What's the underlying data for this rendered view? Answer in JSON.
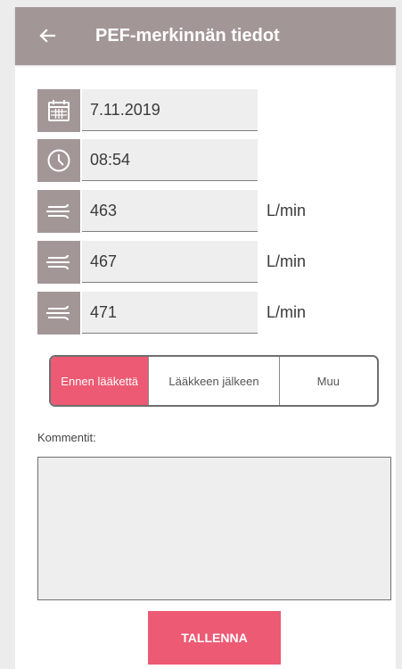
{
  "appbar": {
    "title": "PEF-merkinnän tiedot",
    "back_icon": "arrow-left-icon"
  },
  "fields": {
    "date": {
      "value": "7.11.2019",
      "icon": "calendar-icon"
    },
    "time": {
      "value": "08:54",
      "icon": "clock-icon"
    },
    "readings": [
      {
        "value": "463",
        "unit": "L/min",
        "icon": "airflow-icon"
      },
      {
        "value": "467",
        "unit": "L/min",
        "icon": "airflow-icon"
      },
      {
        "value": "471",
        "unit": "L/min",
        "icon": "airflow-icon"
      }
    ]
  },
  "timing": {
    "options": [
      "Ennen lääkettä",
      "Lääkkeen jälkeen",
      "Muu"
    ],
    "selected": "Ennen lääkettä"
  },
  "comment": {
    "label": "Kommentit:",
    "value": ""
  },
  "save_label": "TALLENNA",
  "colors": {
    "appbar": "#a39697",
    "accent": "#ec5a73"
  }
}
